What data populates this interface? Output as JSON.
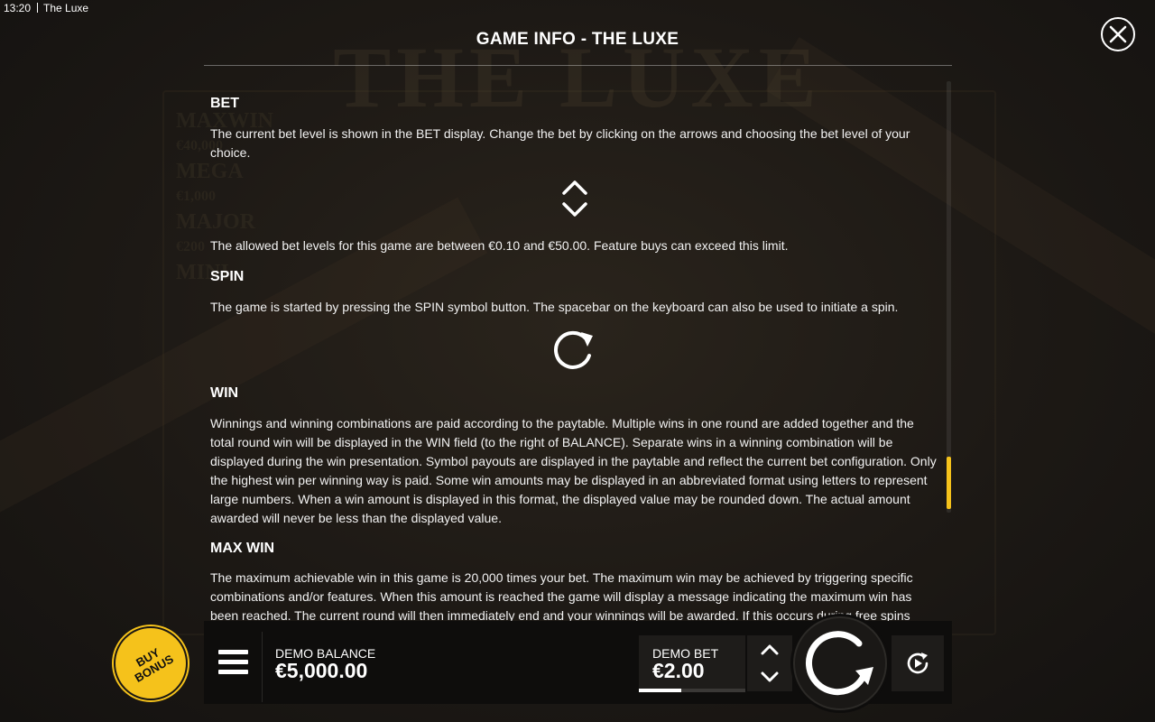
{
  "status": {
    "time": "13:20",
    "app_title": "The Luxe"
  },
  "background": {
    "logo": "THE LUXE",
    "side_text": [
      "MAXWIN",
      "€40,000",
      "MEGA",
      "€1,000",
      "MAJOR",
      "€200",
      "MINI"
    ]
  },
  "info": {
    "title": "GAME INFO - THE LUXE",
    "sections": [
      {
        "heading": "BET",
        "paragraphs": [
          "The current bet level is shown in the BET display. Change the bet by clicking on the arrows and choosing the bet level of your choice.",
          "The allowed bet levels for this game are between €0.10 and €50.00. Feature buys can exceed this limit."
        ]
      },
      {
        "heading": "SPIN",
        "paragraphs": [
          "The game is started by pressing the SPIN symbol button. The spacebar on the keyboard can also be used to initiate a spin."
        ]
      },
      {
        "heading": "WIN",
        "paragraphs": [
          "Winnings and winning combinations are paid according to the paytable. Multiple wins in one round are added together and the total round win will be displayed in the WIN field (to the right of BALANCE). Separate wins in a winning combination will be displayed during the win presentation. Symbol payouts are displayed in the paytable and reflect the current bet configuration. Only the highest win per winning way is paid. Some win amounts may be displayed in an abbreviated format using letters to represent large numbers. When a win amount is displayed in this format, the displayed value may be rounded down. The actual amount awarded will never be less than the displayed value."
        ]
      },
      {
        "heading": "MAX WIN",
        "paragraphs": [
          "The maximum achievable win in this game is 20,000 times your bet. The maximum win may be achieved by triggering specific combinations and/or features. When this amount is reached the game will display a message indicating the maximum win has been reached. The current round will then immediately end and your winnings will be awarded. If this occurs during free spins and/or"
        ]
      }
    ]
  },
  "controls": {
    "buy_bonus": [
      "BUY",
      "BONUS"
    ],
    "balance_label": "DEMO BALANCE",
    "balance_value": "€5,000.00",
    "bet_label": "DEMO BET",
    "bet_value": "€2.00",
    "bet_level_fraction": 0.4
  },
  "colors": {
    "accent": "#f5c21b",
    "panel": "#0e0d0c"
  },
  "icons": {
    "close": "close-icon",
    "bet_arrows": "chevron-up-down-icon",
    "spin": "spin-icon",
    "menu": "hamburger-menu-icon",
    "autoplay": "autoplay-icon"
  }
}
